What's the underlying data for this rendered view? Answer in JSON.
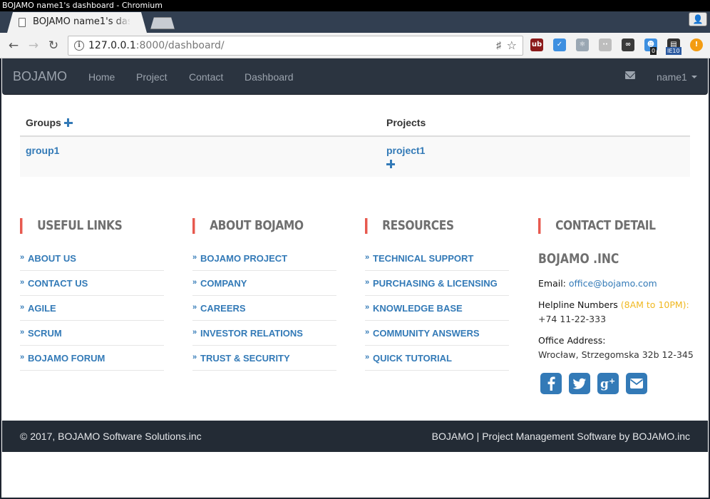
{
  "window": {
    "title": "BOJAMO name1's dashboard - Chromium"
  },
  "browser": {
    "tab_title": "BOJAMO name1's dashboard",
    "url_host": "127.0.0.1",
    "url_rest": ":8000/dashboard/",
    "extensions": [
      {
        "name": "ublock-icon",
        "label": "ub",
        "color": "#8b1a1a"
      },
      {
        "name": "extension-blue-icon",
        "label": "✓",
        "color": "#3d8fe0"
      },
      {
        "name": "react-devtools-icon",
        "label": "⚛",
        "color": "#9aa7b3"
      },
      {
        "name": "extension-dots-icon",
        "label": "··",
        "color": "#bdbdbd"
      },
      {
        "name": "extension-link-icon",
        "label": "∞",
        "color": "#3a3a3a"
      },
      {
        "name": "ghostery-icon",
        "label": "☻",
        "color": "#3d8fe0",
        "badge": "0"
      },
      {
        "name": "ie-tab-icon",
        "label": "▤",
        "color": "#333333",
        "badge": "IE10"
      },
      {
        "name": "alert-extension-icon",
        "label": "!",
        "color": "#f39c12"
      }
    ]
  },
  "navbar": {
    "brand": "BOJAMO",
    "links": [
      "Home",
      "Project",
      "Contact",
      "Dashboard"
    ],
    "user": "name1"
  },
  "table": {
    "headers": {
      "groups": "Groups",
      "projects": "Projects"
    },
    "groups": [
      "group1"
    ],
    "projects": [
      "project1"
    ]
  },
  "footer": {
    "useful_links": {
      "title": "USEFUL LINKS",
      "items": [
        "ABOUT US",
        "CONTACT US",
        "AGILE",
        "SCRUM",
        "BOJAMO FORUM"
      ]
    },
    "about": {
      "title": "ABOUT BOJAMO",
      "items": [
        "BOJAMO PROJECT",
        "COMPANY",
        "CAREERS",
        "INVESTOR RELATIONS",
        "TRUST & SECURITY"
      ]
    },
    "resources": {
      "title": "RESOURCES",
      "items": [
        "TECHNICAL SUPPORT",
        "PURCHASING & LICENSING",
        "KNOWLEDGE BASE",
        "COMMUNITY ANSWERS",
        "QUICK TUTORIAL"
      ]
    },
    "contact": {
      "title": "CONTACT DETAIL",
      "company": "BOJAMO .INC",
      "email_label": "Email:",
      "email": "office@bojamo.com",
      "helpline_label": "Helpline Numbers",
      "helpline_hours": "(8AM to 10PM):",
      "phone": "+74 11-22-333",
      "address_label": "Office Address:",
      "address": "Wrocław, Strzegomska 32b 12-345",
      "social": [
        "facebook-icon",
        "twitter-icon",
        "google-plus-icon",
        "email-icon"
      ]
    }
  },
  "bottom": {
    "copyright": "© 2017, BOJAMO Software Solutions.inc",
    "tagline": "BOJAMO | Project Management Software by BOJAMO.inc"
  }
}
